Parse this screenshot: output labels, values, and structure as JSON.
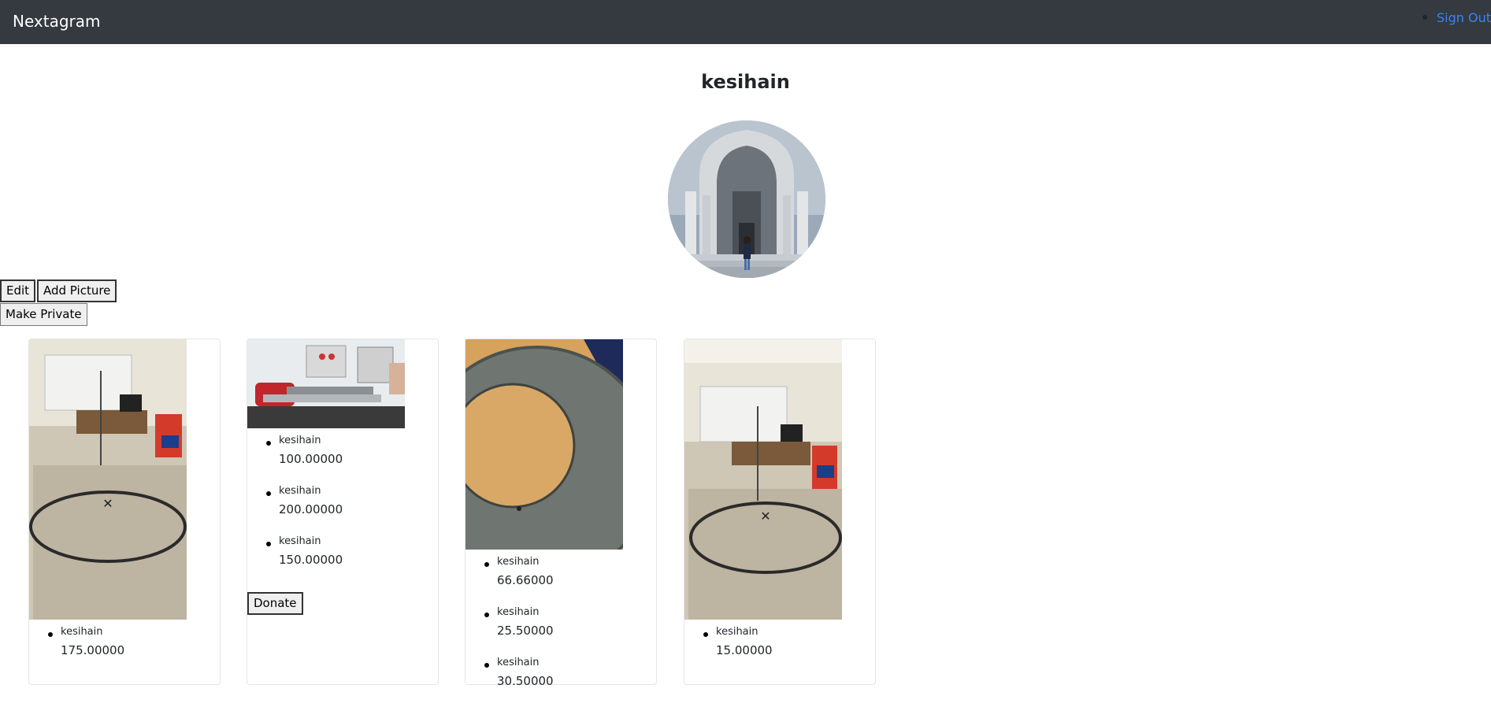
{
  "navbar": {
    "brand": "Nextagram",
    "sign_out": "Sign Out"
  },
  "profile": {
    "username": "kesihain",
    "avatar_icon": "profile-photo-mosque-arch"
  },
  "actions": {
    "edit": "Edit",
    "add_picture": "Add Picture",
    "make_private": "Make Private"
  },
  "cards": [
    {
      "image": "lab-floor-circle-photo",
      "donations": [
        {
          "donor": "kesihain",
          "amount": "175.00000"
        }
      ]
    },
    {
      "image": "lab-machine-photo",
      "donations": [
        {
          "donor": "kesihain",
          "amount": "100.00000"
        },
        {
          "donor": "kesihain",
          "amount": "200.00000"
        },
        {
          "donor": "kesihain",
          "amount": "150.00000"
        }
      ],
      "donate_label": "Donate"
    },
    {
      "image": "metal-disc-photo",
      "donations": [
        {
          "donor": "kesihain",
          "amount": "66.66000"
        },
        {
          "donor": "kesihain",
          "amount": "25.50000"
        },
        {
          "donor": "kesihain",
          "amount": "30.50000"
        }
      ]
    },
    {
      "image": "lab-floor-circle-photo-2",
      "donations": [
        {
          "donor": "kesihain",
          "amount": "15.00000"
        }
      ]
    }
  ],
  "colors": {
    "navbar_bg": "#343a40",
    "link": "#3b82f6"
  }
}
